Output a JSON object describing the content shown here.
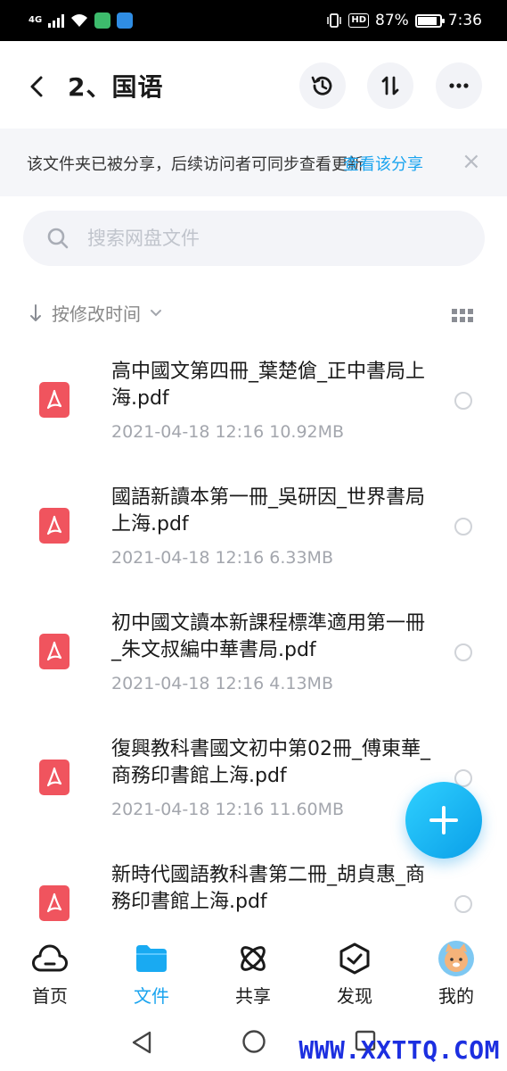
{
  "status_bar": {
    "network": "4G",
    "hd": "HD",
    "battery": "87%",
    "time": "7:36"
  },
  "header": {
    "title": "2、国语"
  },
  "banner": {
    "text": "该文件夹已被分享，后续访问者可同步查看更新",
    "link": "查看该分享",
    "close": "×"
  },
  "search": {
    "placeholder": "搜索网盘文件"
  },
  "sort": {
    "label": "按修改时间"
  },
  "files": [
    {
      "name": "高中國文第四冊_葉楚傖_正中書局上海.pdf",
      "meta": "2021-04-18  12:16   10.92MB"
    },
    {
      "name": "國語新讀本第一冊_吳研因_世界書局上海.pdf",
      "meta": "2021-04-18  12:16   6.33MB"
    },
    {
      "name": "初中國文讀本新課程標準適用第一冊_朱文叔編中華書局.pdf",
      "meta": "2021-04-18  12:16   4.13MB"
    },
    {
      "name": "復興教科書國文初中第02冊_傅東華_商務印書館上海.pdf",
      "meta": "2021-04-18  12:16   11.60MB"
    },
    {
      "name": "新時代國語教科書第二冊_胡貞惠_商務印書館上海.pdf",
      "meta": ""
    }
  ],
  "bottom_nav": [
    {
      "label": "首页",
      "icon": "cloud-icon"
    },
    {
      "label": "文件",
      "icon": "folder-icon",
      "active": true
    },
    {
      "label": "共享",
      "icon": "atom-icon"
    },
    {
      "label": "发现",
      "icon": "discover-icon"
    },
    {
      "label": "我的",
      "icon": "avatar"
    }
  ],
  "watermark": "WWW.XXTTQ.COM",
  "colors": {
    "accent": "#1aa4ef",
    "pdf": "#f0545e",
    "fab": "#17b4f5"
  }
}
